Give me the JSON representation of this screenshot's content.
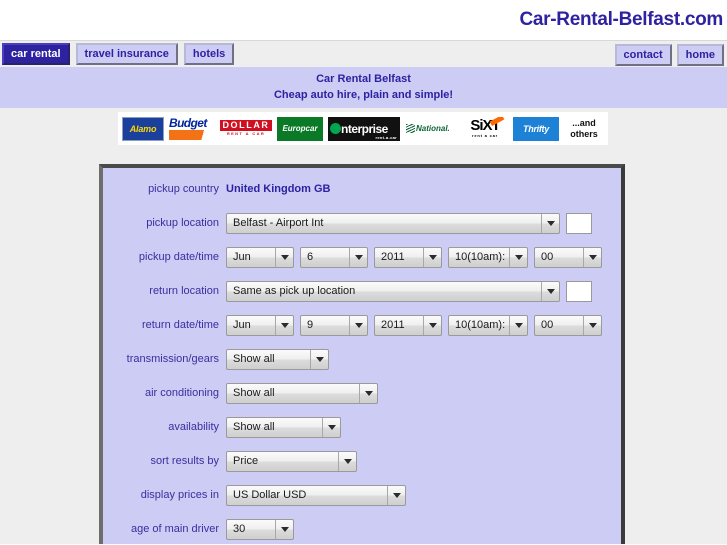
{
  "header": {
    "site_title": "Car-Rental-Belfast.com"
  },
  "nav": {
    "left_items": [
      {
        "label": "car rental",
        "active": true
      },
      {
        "label": "travel insurance",
        "active": false
      },
      {
        "label": "hotels",
        "active": false
      }
    ],
    "right_items": [
      {
        "label": "contact"
      },
      {
        "label": "home"
      }
    ]
  },
  "tagline": {
    "line1": "Car Rental Belfast",
    "line2": "Cheap auto hire, plain and simple!"
  },
  "logos": [
    {
      "name": "alamo-logo",
      "label": "Alamo"
    },
    {
      "name": "budget-logo",
      "label": "Budget"
    },
    {
      "name": "dollar-logo",
      "label": "DOLLAR",
      "sub": "RENT A CAR"
    },
    {
      "name": "europcar-logo",
      "label": "Europcar"
    },
    {
      "name": "enterprise-logo",
      "label": "nterprise",
      "sub": "rent-a-car"
    },
    {
      "name": "national-logo",
      "label": "National."
    },
    {
      "name": "sixt-logo",
      "label": "SiXT",
      "sub": "rent a car"
    },
    {
      "name": "thrifty-logo",
      "label": "Thrifty"
    },
    {
      "name": "and-others-label",
      "line1": "...and",
      "line2": "others"
    }
  ],
  "form": {
    "rows": {
      "pickup_country": {
        "label": "pickup country",
        "value": "United Kingdom GB"
      },
      "pickup_location": {
        "label": "pickup location",
        "value": "Belfast - Airport Int",
        "extra_text": ""
      },
      "pickup_datetime": {
        "label": "pickup date/time",
        "month": "Jun",
        "day": "6",
        "year": "2011",
        "hour": "10(10am):",
        "minute": "00"
      },
      "return_location": {
        "label": "return location",
        "value": "Same as pick up location",
        "extra_text": ""
      },
      "return_datetime": {
        "label": "return date/time",
        "month": "Jun",
        "day": "9",
        "year": "2011",
        "hour": "10(10am):",
        "minute": "00"
      },
      "transmission": {
        "label": "transmission/gears",
        "value": "Show all"
      },
      "air_conditioning": {
        "label": "air conditioning",
        "value": "Show all"
      },
      "availability": {
        "label": "availability",
        "value": "Show all"
      },
      "sort_results": {
        "label": "sort results by",
        "value": "Price"
      },
      "display_prices": {
        "label": "display prices in",
        "value": "US Dollar USD"
      },
      "driver_age": {
        "label": "age of main driver",
        "value": "30"
      }
    }
  },
  "colors": {
    "brand_purple": "#2d22a0",
    "panel_lavender": "#ccccf5",
    "page_gray": "#eeeeee",
    "label_purple": "#3a2f9e"
  }
}
